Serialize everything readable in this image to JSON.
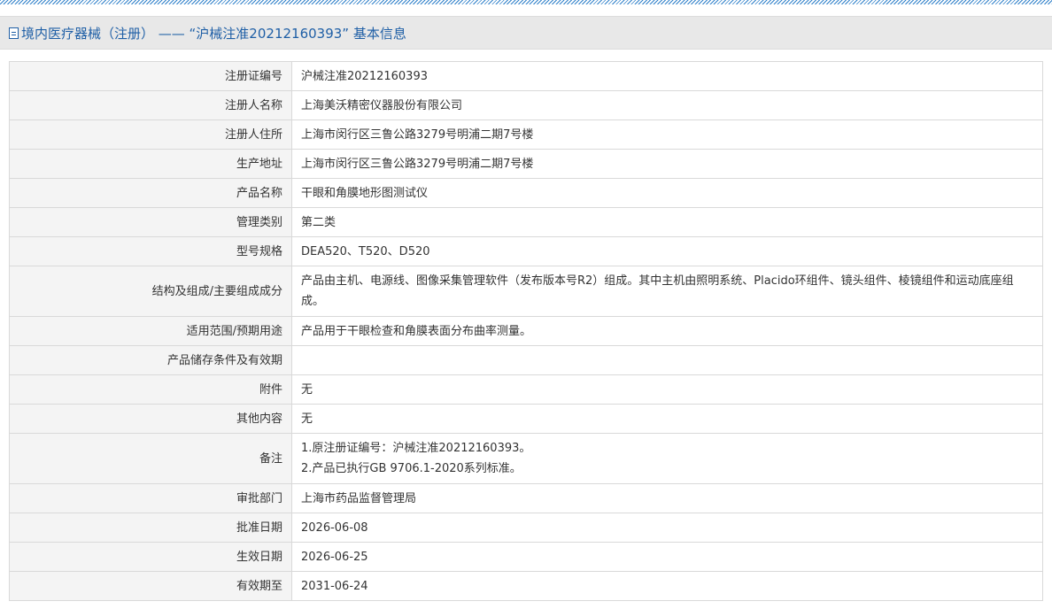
{
  "header": {
    "title": "境内医疗器械（注册） —— “沪械注准20212160393” 基本信息"
  },
  "rows": [
    {
      "label": "注册证编号",
      "value": "沪械注准20212160393"
    },
    {
      "label": "注册人名称",
      "value": "上海美沃精密仪器股份有限公司"
    },
    {
      "label": "注册人住所",
      "value": "上海市闵行区三鲁公路3279号明浦二期7号楼"
    },
    {
      "label": "生产地址",
      "value": "上海市闵行区三鲁公路3279号明浦二期7号楼"
    },
    {
      "label": "产品名称",
      "value": "干眼和角膜地形图测试仪"
    },
    {
      "label": "管理类别",
      "value": "第二类"
    },
    {
      "label": "型号规格",
      "value": "DEA520、T520、D520"
    },
    {
      "label": "结构及组成/主要组成成分",
      "value": "产品由主机、电源线、图像采集管理软件（发布版本号R2）组成。其中主机由照明系统、Placido环组件、镜头组件、棱镜组件和运动底座组成。"
    },
    {
      "label": "适用范围/预期用途",
      "value": "产品用于干眼检查和角膜表面分布曲率测量。"
    },
    {
      "label": "产品储存条件及有效期",
      "value": ""
    },
    {
      "label": "附件",
      "value": "无"
    },
    {
      "label": "其他内容",
      "value": "无"
    },
    {
      "label": "备注",
      "value_lines": [
        "1.原注册证编号：沪械注准20212160393。",
        "2.产品已执行GB 9706.1-2020系列标准。"
      ]
    },
    {
      "label": "审批部门",
      "value": "上海市药品监督管理局"
    },
    {
      "label": "批准日期",
      "value": "2026-06-08"
    },
    {
      "label": "生效日期",
      "value": "2026-06-25"
    },
    {
      "label": "有效期至",
      "value": "2031-06-24"
    }
  ],
  "colors": {
    "header_text": "#1f5fa6",
    "label_bg": "#f4f4f4",
    "border": "#d9d9d9"
  }
}
